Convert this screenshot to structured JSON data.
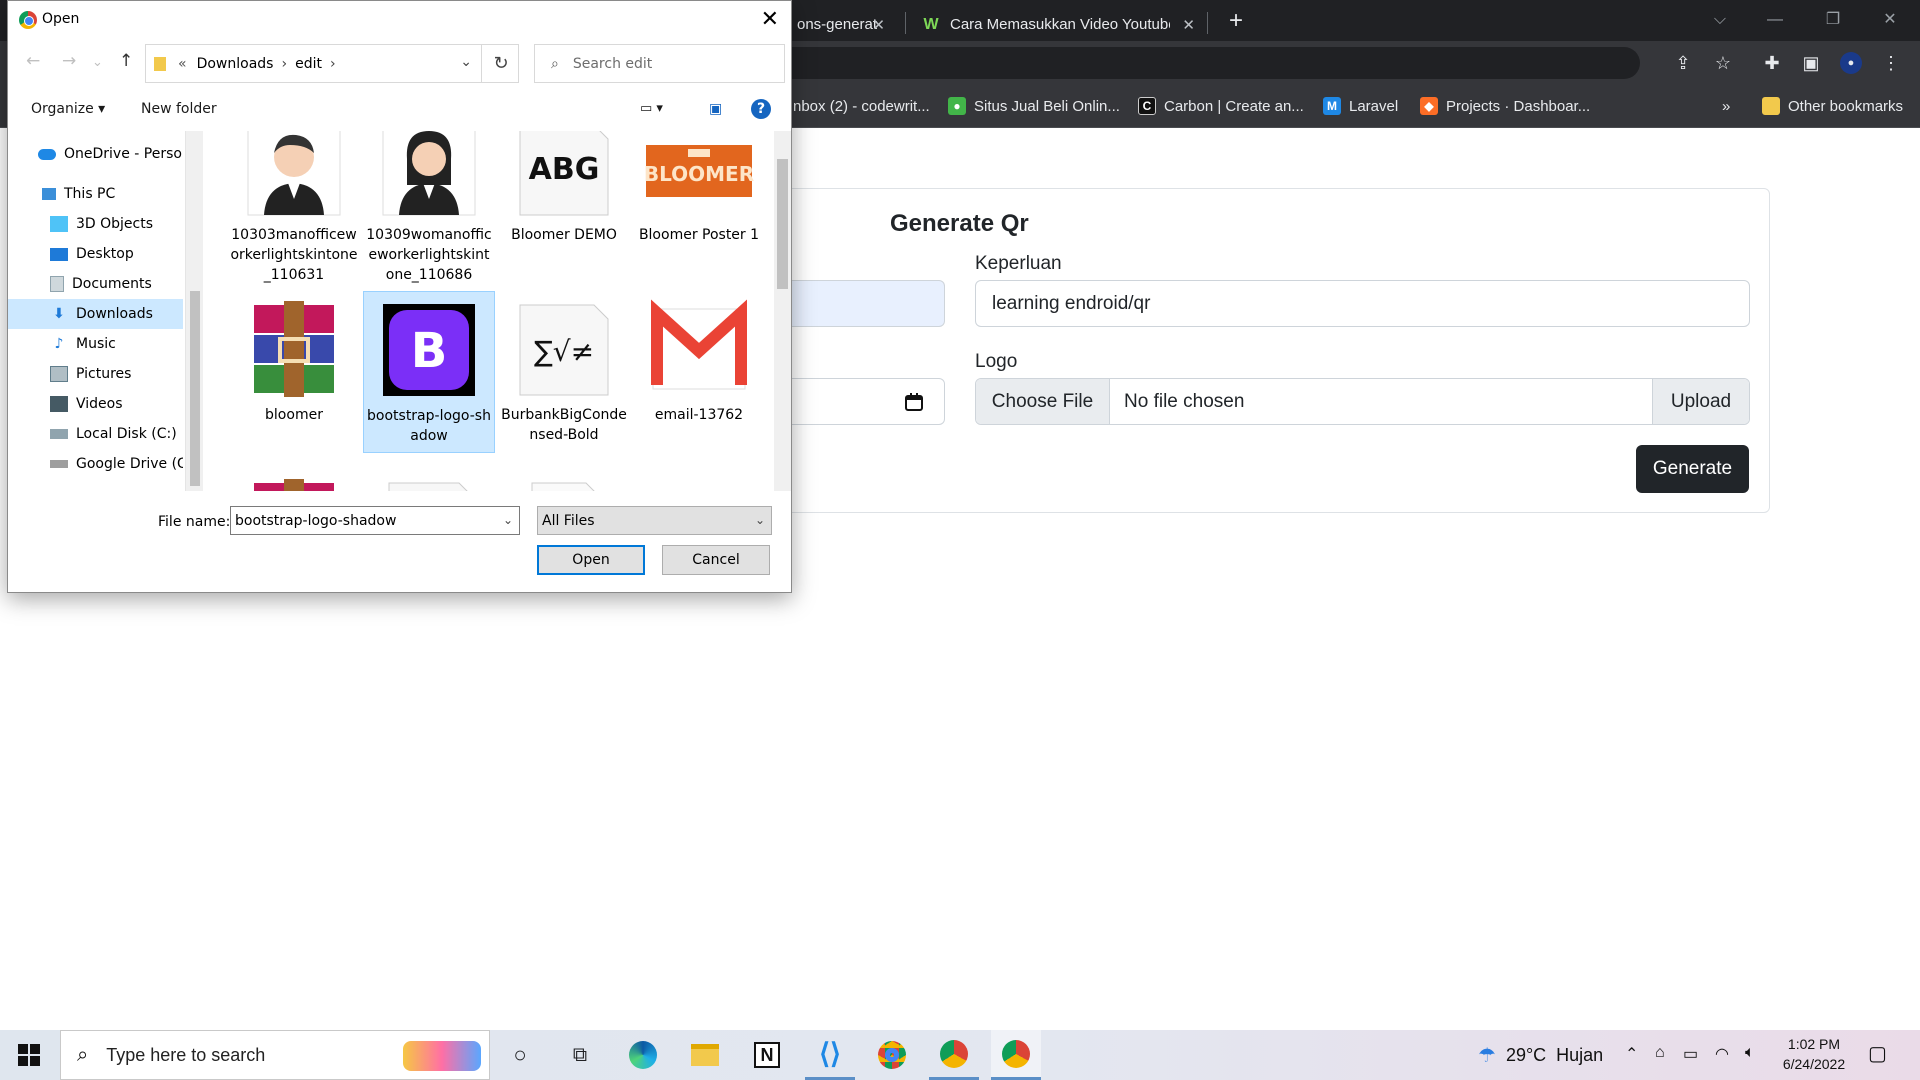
{
  "browser": {
    "tabs": [
      {
        "label": "ons-generat",
        "favicon": "doc-icon"
      },
      {
        "label": "Cara Memasukkan Video Youtube",
        "favicon": "w-icon"
      }
    ],
    "bookmarks": [
      {
        "label": "nbox (2) - codewrit...",
        "color": "#d93025",
        "icon": "gmail-icon"
      },
      {
        "label": "Situs Jual Beli Onlin...",
        "color": "#42b549",
        "icon": "tokopedia-icon"
      },
      {
        "label": "Carbon | Create an...",
        "color": "#111111",
        "icon": "carbon-icon"
      },
      {
        "label": "Laravel",
        "color": "#1e88e5",
        "icon": "laravel-icon"
      },
      {
        "label": "Projects · Dashboar...",
        "color": "#fc6d26",
        "icon": "gitlab-icon"
      }
    ],
    "bookmarks_more": "»",
    "other_bookmarks": "Other bookmarks"
  },
  "page": {
    "title": "Generate Qr",
    "keperluan_label": "Keperluan",
    "keperluan_value": "learning endroid/qr",
    "logo_label": "Logo",
    "choose_file": "Choose File",
    "no_file": "No file chosen",
    "upload": "Upload",
    "generate": "Generate",
    "accent_color": "#212529"
  },
  "dialog": {
    "title": "Open",
    "breadcrumb": {
      "prefix": "«",
      "parts": [
        "Downloads",
        "edit"
      ]
    },
    "search_placeholder": "Search edit",
    "toolbar": {
      "organize": "Organize ▾",
      "new_folder": "New folder"
    },
    "nav": [
      {
        "label": "OneDrive - Person",
        "icon": "onedrive-icon"
      },
      {
        "label": "This PC",
        "icon": "pc-icon"
      },
      {
        "label": "3D Objects",
        "icon": "cube-icon"
      },
      {
        "label": "Desktop",
        "icon": "desktop-icon"
      },
      {
        "label": "Documents",
        "icon": "documents-icon"
      },
      {
        "label": "Downloads",
        "icon": "download-icon",
        "selected": true
      },
      {
        "label": "Music",
        "icon": "music-icon"
      },
      {
        "label": "Pictures",
        "icon": "pictures-icon"
      },
      {
        "label": "Videos",
        "icon": "videos-icon"
      },
      {
        "label": "Local Disk (C:)",
        "icon": "disk-icon"
      },
      {
        "label": "Google Drive (G:",
        "icon": "drive-icon"
      }
    ],
    "files": [
      {
        "name": "10303manofficeworkerlightskintone_110631",
        "kind": "man"
      },
      {
        "name": "10309womanofficeworkerlightskintone_110686",
        "kind": "woman"
      },
      {
        "name": "Bloomer DEMO",
        "kind": "font"
      },
      {
        "name": "Bloomer Poster 1",
        "kind": "bloomer"
      },
      {
        "name": "bloomer",
        "kind": "rar"
      },
      {
        "name": "bootstrap-logo-shadow",
        "kind": "bootstrap",
        "selected": true
      },
      {
        "name": "BurbankBigCondensed-Bold",
        "kind": "math"
      },
      {
        "name": "email-13762",
        "kind": "gmail"
      }
    ],
    "file_name_label": "File name:",
    "file_name_value": "bootstrap-logo-shadow",
    "filter": "All Files",
    "open": "Open",
    "cancel": "Cancel"
  },
  "taskbar": {
    "search_placeholder": "Type here to search",
    "weather_temp": "29°C",
    "weather_text": "Hujan",
    "time": "1:02 PM",
    "date": "6/24/2022"
  }
}
